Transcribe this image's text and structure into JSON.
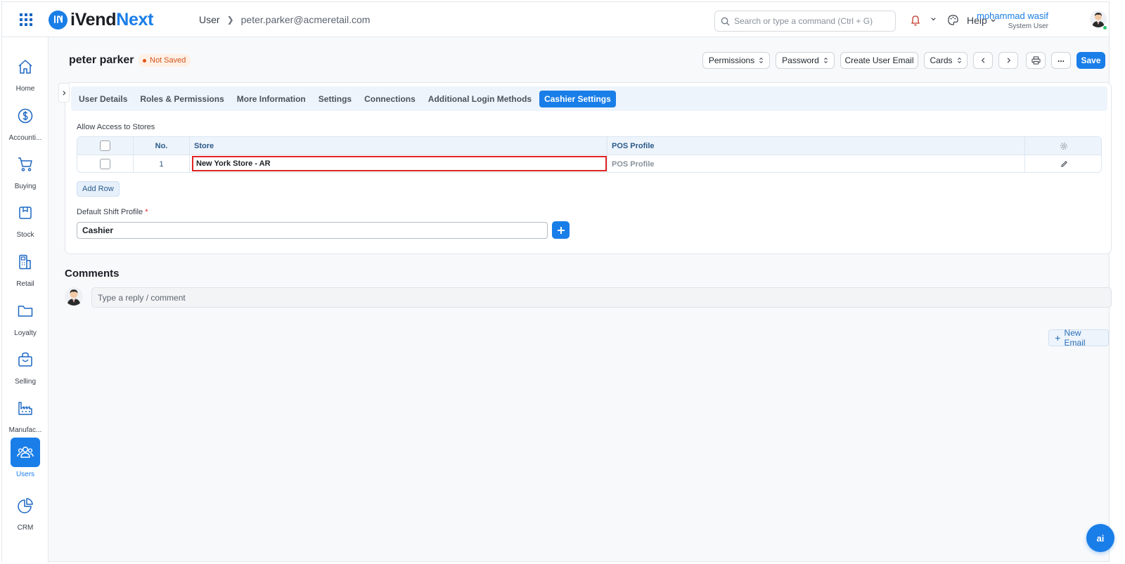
{
  "app": {
    "brand_first": "iVend",
    "brand_second": "Next"
  },
  "breadcrumb": {
    "root": "User",
    "current": "peter.parker@acmeretail.com"
  },
  "search": {
    "placeholder": "Search or type a command (Ctrl + G)"
  },
  "header": {
    "help_label": "Help",
    "user_name": "mohammad wasif",
    "user_role": "System User"
  },
  "sidebar": {
    "items": [
      {
        "label": "Home",
        "icon": "home-icon"
      },
      {
        "label": "Accounti...",
        "icon": "dollar-icon"
      },
      {
        "label": "Buying",
        "icon": "cart-icon"
      },
      {
        "label": "Stock",
        "icon": "box-icon"
      },
      {
        "label": "Retail",
        "icon": "pos-terminal-icon"
      },
      {
        "label": "Loyalty",
        "icon": "folder-icon"
      },
      {
        "label": "Selling",
        "icon": "shopping-bag-icon"
      },
      {
        "label": "Manufac...",
        "icon": "factory-icon"
      },
      {
        "label": "Users",
        "icon": "users-icon",
        "active": true
      },
      {
        "label": "CRM",
        "icon": "pie-chart-icon"
      }
    ]
  },
  "page": {
    "title": "peter parker",
    "status": "Not Saved",
    "buttons": {
      "permissions": "Permissions",
      "password": "Password",
      "create_user_email": "Create User Email",
      "cards": "Cards",
      "more": "...",
      "save": "Save"
    }
  },
  "tabs": [
    {
      "label": "User Details"
    },
    {
      "label": "Roles & Permissions"
    },
    {
      "label": "More Information"
    },
    {
      "label": "Settings"
    },
    {
      "label": "Connections"
    },
    {
      "label": "Additional Login Methods"
    },
    {
      "label": "Cashier Settings",
      "active": true
    }
  ],
  "stores": {
    "section_label": "Allow Access to Stores",
    "columns": {
      "no": "No.",
      "store": "Store",
      "pos_profile": "POS Profile"
    },
    "rows": [
      {
        "no": "1",
        "store": "New York Store - AR",
        "pos_profile_placeholder": "POS Profile"
      }
    ],
    "add_row_label": "Add Row"
  },
  "shift": {
    "label": "Default Shift Profile",
    "required_mark": "*",
    "value": "Cashier"
  },
  "comments": {
    "title": "Comments",
    "placeholder": "Type a reply / comment"
  },
  "new_email_label": "New Email",
  "ai_label": "ai",
  "colors": {
    "primary": "#1a7ee8",
    "status_orange": "#d0541a",
    "highlight_red": "#e02424"
  }
}
